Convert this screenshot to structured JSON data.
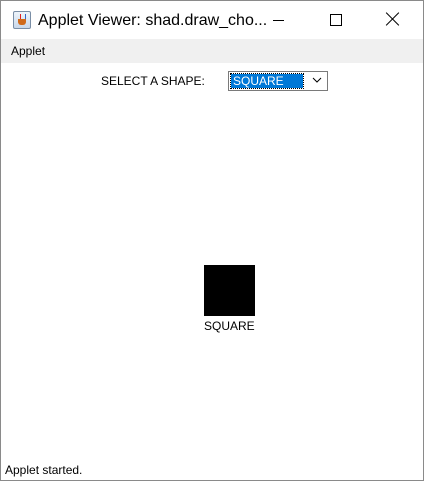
{
  "window": {
    "title": "Applet Viewer: shad.draw_cho...",
    "icon": "java-cup-icon",
    "controls": [
      "minimize-icon",
      "maximize-icon",
      "close-icon"
    ]
  },
  "menubar": {
    "items": [
      "Applet"
    ]
  },
  "applet": {
    "select_label": "SELECT A SHAPE:",
    "select_value": "SQUARE",
    "selection_color": "#0078d7",
    "shape_caption": "SQUARE",
    "shape_color": "#000000"
  },
  "status": {
    "text": "Applet started."
  }
}
